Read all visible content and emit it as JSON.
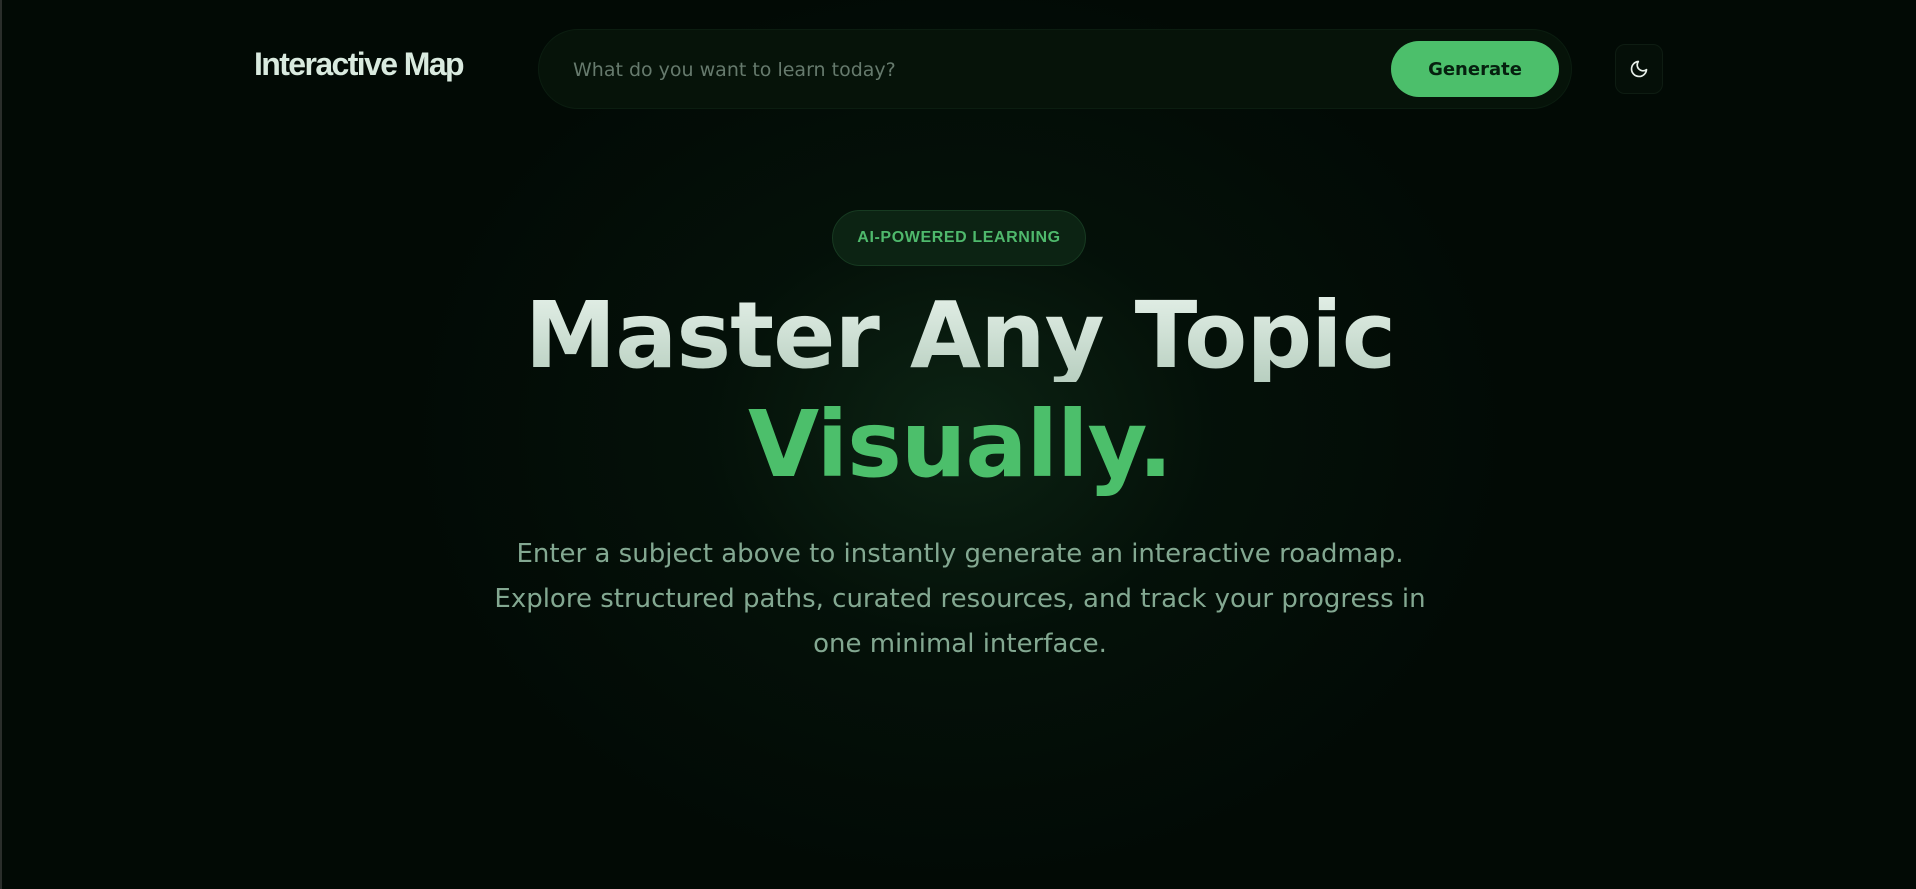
{
  "header": {
    "logo": "Interactive Map",
    "search": {
      "placeholder": "What do you want to learn today?",
      "value": ""
    },
    "generate_label": "Generate",
    "theme_toggle_icon": "moon-icon"
  },
  "hero": {
    "badge": "AI-POWERED LEARNING",
    "title_line_1": "Master Any Topic",
    "title_line_2": "Visually.",
    "subtitle": "Enter a subject above to instantly generate an interactive roadmap. Explore structured paths, curated resources, and track your progress in one minimal interface."
  },
  "colors": {
    "background": "#020a05",
    "accent": "#4cbf6b",
    "text_primary": "#d9eadf",
    "text_muted": "#83a891"
  }
}
